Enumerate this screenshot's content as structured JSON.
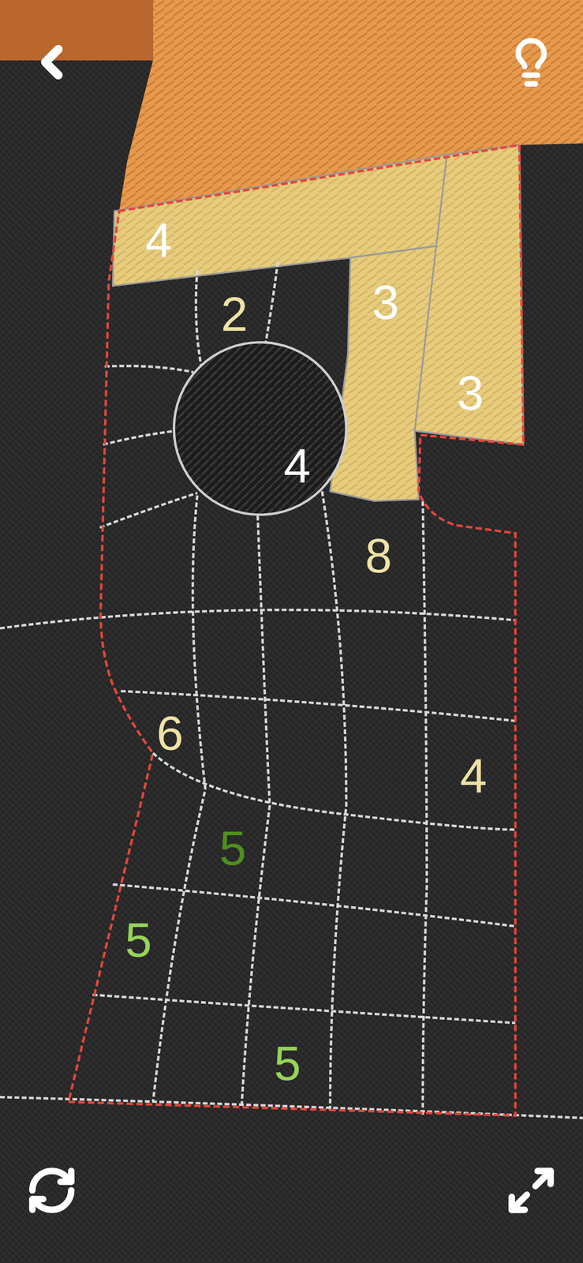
{
  "regions": [
    {
      "number": "4",
      "color": "#ffffff",
      "kind": "yarn",
      "filled": true
    },
    {
      "number": "2",
      "color": "#efe2a6",
      "kind": "open",
      "filled": false
    },
    {
      "number": "3",
      "color": "#ffffff",
      "kind": "yarn",
      "filled": true
    },
    {
      "number": "3",
      "color": "#ffffff",
      "kind": "yarn",
      "filled": true
    },
    {
      "number": "4",
      "color": "#ffffff",
      "kind": "knot",
      "filled": true
    },
    {
      "number": "8",
      "color": "#efe2a6",
      "kind": "open",
      "filled": false
    },
    {
      "number": "6",
      "color": "#efe2a6",
      "kind": "open",
      "filled": false
    },
    {
      "number": "4",
      "color": "#efe2a6",
      "kind": "open",
      "filled": false
    },
    {
      "number": "5",
      "color": "#4f8f1c",
      "kind": "open",
      "filled": false
    },
    {
      "number": "5",
      "color": "#96d45a",
      "kind": "open",
      "filled": false
    },
    {
      "number": "5",
      "color": "#96d45a",
      "kind": "open",
      "filled": false
    }
  ]
}
